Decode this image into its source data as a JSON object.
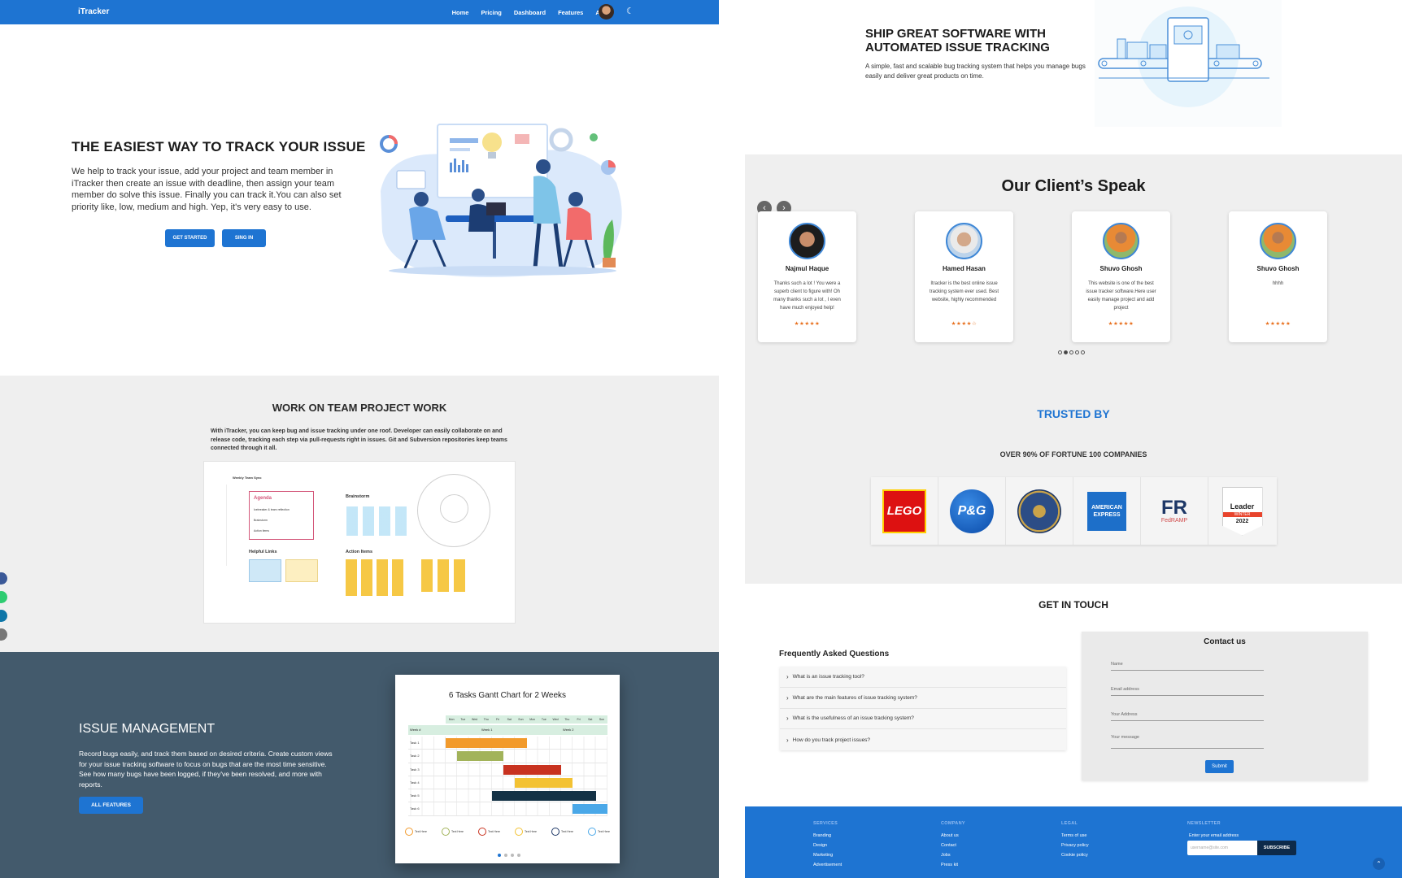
{
  "navbar": {
    "brand": "iTracker",
    "links": [
      "Home",
      "Pricing",
      "Dashboard",
      "Features",
      "About"
    ]
  },
  "hero": {
    "title": "THE EASIEST WAY TO TRACK YOUR ISSUE",
    "text": "We help to track your issue, add your project and team member in iTracker then create an issue with deadline, then assign your team member do solve this issue. Finally you can track it.You can also set priority like, low, medium and high. Yep, it's very easy to use.",
    "get_started": "GET STARTED",
    "sign_in": "SING IN"
  },
  "team": {
    "title": "WORK ON TEAM PROJECT WORK",
    "text": "With iTracker, you can keep bug and issue tracking under one roof. Developer can easily collaborate on and release code, tracking each step via pull-requests right in issues. Git and Subversion repositories keep teams connected through it all.",
    "board": {
      "header": "Weekly Team Sync",
      "agenda_title": "Agenda",
      "agenda_items": [
        "Icebreaker & team reflection",
        "Brainstorm",
        "Action items"
      ],
      "brainstorm": "Brainstorm",
      "helpful_links": "Helpful Links",
      "action_items": "Action Items"
    }
  },
  "issue": {
    "title": "ISSUE MANAGEMENT",
    "text": "Record bugs easily, and track them based on desired criteria. Create custom views for your issue tracking software to focus on bugs that are the most time sensitive. See how many bugs have been logged, if they've been resolved, and more with reports.",
    "button": "ALL FEATURES",
    "gantt": {
      "title": "6 Tasks Gantt Chart for 2 Weeks",
      "days": [
        "Mon",
        "Tue",
        "Wed",
        "Thu",
        "Fri",
        "Sat",
        "Sun",
        "Mon",
        "Tue",
        "Wed",
        "Thu",
        "Fri",
        "Sat",
        "Sun"
      ],
      "weeks_label": "Week #",
      "week1": "Week 1",
      "week2": "Week 2",
      "tasks": [
        "Task 1",
        "Task 2",
        "Task 3",
        "Task 4",
        "Task 5",
        "Task 6"
      ],
      "legend_label": "Text Here"
    }
  },
  "ship": {
    "title": "SHIP GREAT SOFTWARE WITH AUTOMATED ISSUE TRACKING",
    "text": "A simple, fast and scalable bug tracking system that helps you manage bugs easily and deliver great products on time."
  },
  "clients": {
    "title": "Our Client’s Speak",
    "reviews": [
      {
        "name": "Najmul Haque",
        "text": "Thanks such a lot ! You were a superb client to figure with! Oh many thanks such a lot , I even have much enjoyed help!",
        "stars": "★★★★★"
      },
      {
        "name": "Hamed Hasan",
        "text": "Itracker is the best online issue tracking system ever used. Best website, highly recommended",
        "stars": "★★★★☆"
      },
      {
        "name": "Shuvo Ghosh",
        "text": "This website is one of the best issue tracker software.Here user easily manage project and add project",
        "stars": "★★★★★"
      },
      {
        "name": "Shuvo Ghosh",
        "text": "hhhh",
        "stars": "★★★★★"
      }
    ]
  },
  "trusted": {
    "title": "TRUSTED BY",
    "subtitle": "OVER 90% OF FORTUNE 100 COMPANIES",
    "logos": {
      "lego": "LEGO",
      "pg": "P&G",
      "amex_1": "AMERICAN",
      "amex_2": "EXPRESS",
      "fr": "FR",
      "fedramp": "FedRAMP",
      "leader": "Leader",
      "winter": "WINTER",
      "year": "2022"
    }
  },
  "contact": {
    "title": "GET IN TOUCH",
    "faq_title": "Frequently Asked Questions",
    "faqs": [
      "What is an issue tracking tool?",
      "What are the main features of issue tracking system?",
      "What is the usefulness of an issue tracking system?",
      "How do you track project issues?"
    ],
    "form_title": "Contact us",
    "fields": [
      "Name",
      "Email address",
      "Your Address",
      "Your message"
    ],
    "submit": "Submit"
  },
  "footer": {
    "services": {
      "head": "SERVICES",
      "items": [
        "Branding",
        "Design",
        "Marketing",
        "Advertisement"
      ]
    },
    "company": {
      "head": "COMPANY",
      "items": [
        "About us",
        "Contact",
        "Jobs",
        "Press kit"
      ]
    },
    "legal": {
      "head": "LEGAL",
      "items": [
        "Terms of use",
        "Privacy policy",
        "Cookie policy"
      ]
    },
    "newsletter": {
      "head": "NEWSLETTER",
      "label": "Enter your email address",
      "placeholder": "username@site.com",
      "button": "SUBSCRIBE"
    }
  },
  "colors": {
    "primary": "#1e74d2",
    "section_grey": "#efefef",
    "issue_bg": "#435a6c",
    "star": "#e8701e"
  },
  "icons": {
    "moon": "moon-icon",
    "arrows": [
      "chevron-left-icon",
      "chevron-right-icon"
    ],
    "scroll_top": "chevron-up-icon"
  }
}
